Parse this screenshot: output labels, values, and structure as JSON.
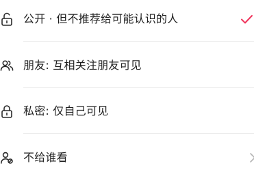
{
  "visibility_options": [
    {
      "label": "公开 · 但不推荐给可能认识的人",
      "icon": "lock-open-icon",
      "selected": true
    },
    {
      "label": "朋友: 互相关注朋友可见",
      "icon": "friends-icon",
      "selected": false
    },
    {
      "label": "私密: 仅自己可见",
      "icon": "lock-icon",
      "selected": false
    },
    {
      "label": "不给谁看",
      "icon": "person-block-icon",
      "selected": false
    }
  ],
  "colors": {
    "accent": "#f0365d",
    "text": "#1f1f1f",
    "icon": "#2a2a2a",
    "chevron": "#b5b5b5",
    "divider": "#ececec"
  }
}
